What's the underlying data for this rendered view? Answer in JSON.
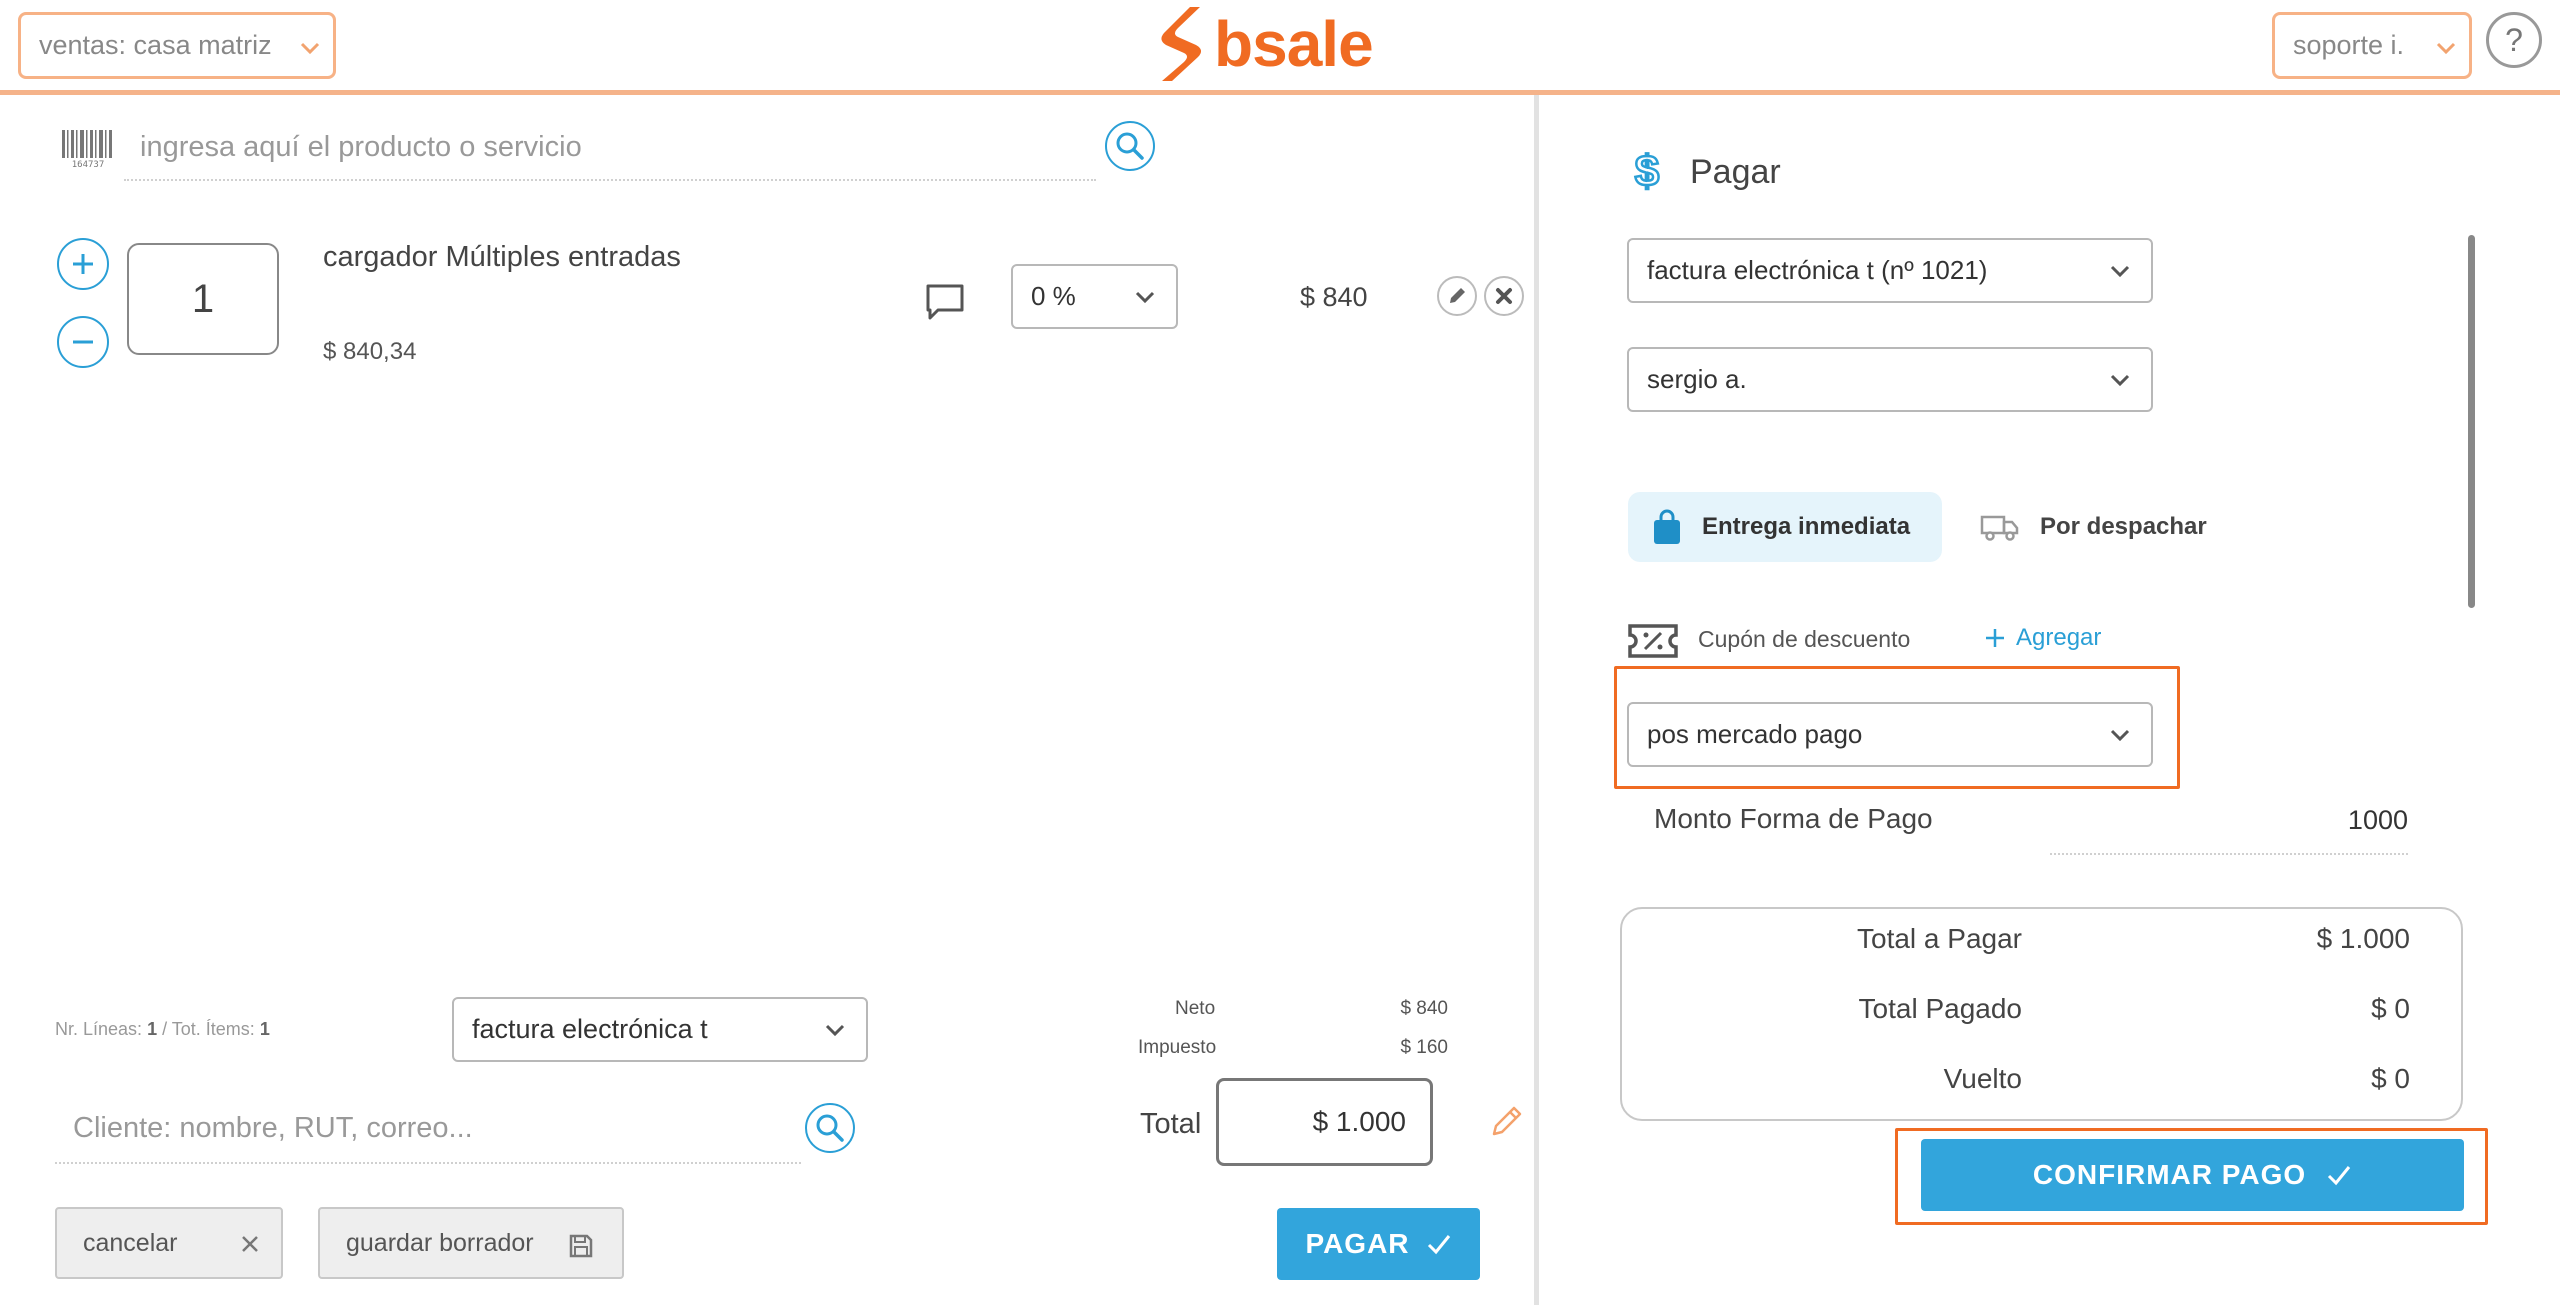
{
  "header": {
    "branch_select": "ventas: casa matriz",
    "logo_text": "bsale",
    "user_select": "soporte i.",
    "help_label": "?"
  },
  "left": {
    "product_search_placeholder": "ingresa aquí el producto o servicio",
    "line": {
      "quantity": "1",
      "name": "cargador Múltiples entradas",
      "unit_price": "$ 840,34",
      "discount": "0 %",
      "line_total": "$ 840"
    },
    "counts": {
      "lines_label": "Nr. Líneas:",
      "lines_value": "1",
      "items_label": "/ Tot. Ítems:",
      "items_value": "1"
    },
    "document_type": "factura electrónica t",
    "client_placeholder": "Cliente: nombre, RUT, correo...",
    "totals": {
      "neto_label": "Neto",
      "neto_value": "$ 840",
      "impuesto_label": "Impuesto",
      "impuesto_value": "$ 160",
      "total_label": "Total",
      "total_value": "$ 1.000"
    },
    "buttons": {
      "cancel": "cancelar",
      "save_draft": "guardar borrador",
      "pay": "PAGAR"
    }
  },
  "right": {
    "title": "Pagar",
    "document_select": "factura electrónica t (nº 1021)",
    "seller_select": "sergio a.",
    "delivery": {
      "immediate": "Entrega inmediata",
      "dispatch": "Por despachar"
    },
    "coupon_label": "Cupón de descuento",
    "coupon_add": "Agregar",
    "payment_method": "pos mercado pago",
    "amount_label": "Monto Forma de Pago",
    "amount_value": "1000",
    "summary": {
      "total_label": "Total a Pagar",
      "total_value": "$ 1.000",
      "paid_label": "Total Pagado",
      "paid_value": "$ 0",
      "change_label": "Vuelto",
      "change_value": "$ 0"
    },
    "confirm_button": "CONFIRMAR PAGO"
  },
  "colors": {
    "accent_blue": "#32a5dc",
    "brand_orange": "#f06b22",
    "highlight_frame": "#f06b22"
  }
}
